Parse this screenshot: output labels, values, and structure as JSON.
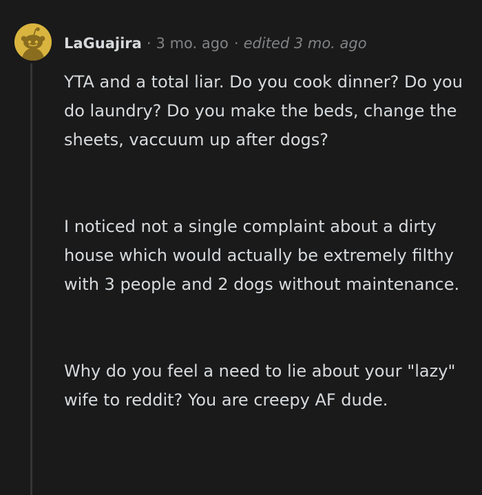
{
  "comment": {
    "author": "LaGuajira",
    "separator": "·",
    "time": "3 mo. ago",
    "edited": "edited 3 mo. ago",
    "avatar_icon": "snoo-avatar-icon",
    "paragraphs": [
      "YTA and a total liar. Do you cook dinner? Do you do laundry? Do you make the beds, change the sheets, vaccuum up after dogs?",
      "I noticed not a single complaint about a dirty house which would actually be extremely filthy with 3 people and 2 dogs without maintenance.",
      "Why do you feel a need to lie about your \"lazy\" wife to reddit? You are creepy AF dude."
    ]
  },
  "colors": {
    "background": "#1a1a1b",
    "text": "#d7dadc",
    "meta": "#818384",
    "avatar": "#d9b43f",
    "thread_line": "#343536"
  }
}
